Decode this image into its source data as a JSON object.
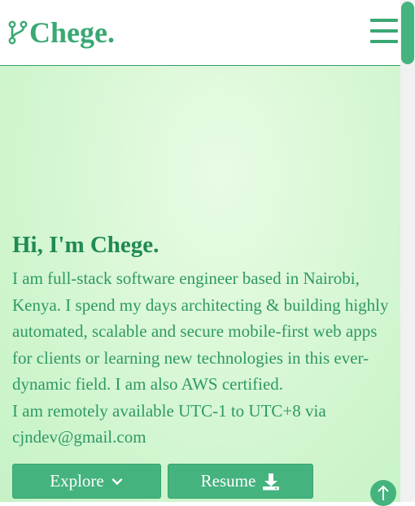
{
  "header": {
    "brand": "Chege.",
    "logo_icon": "branch-icon",
    "menu_icon": "hamburger-menu-icon"
  },
  "hero": {
    "title": "Hi, I'm Chege.",
    "lines": [
      "I am full-stack software engineer based in Nairobi,",
      "Kenya. I spend my days architecting & building highly",
      "automated, scalable and secure mobile-first web apps",
      "for clients or learning new technologies in this ever-",
      "dynamic field. I am also AWS certified.",
      "I am remotely available UTC-1 to UTC+8 via",
      "cjndev@gmail.com"
    ]
  },
  "buttons": {
    "explore_label": "Explore",
    "explore_icon": "chevron-down-icon",
    "resume_label": "Resume",
    "resume_icon": "download-icon"
  },
  "back_to_top_icon": "arrow-up-icon",
  "colors": {
    "accent": "#45b37d",
    "brand_text": "#3aa873",
    "heading": "#1f8a54",
    "body_text": "#2e9964",
    "hero_bg": "#d6f7d3"
  }
}
